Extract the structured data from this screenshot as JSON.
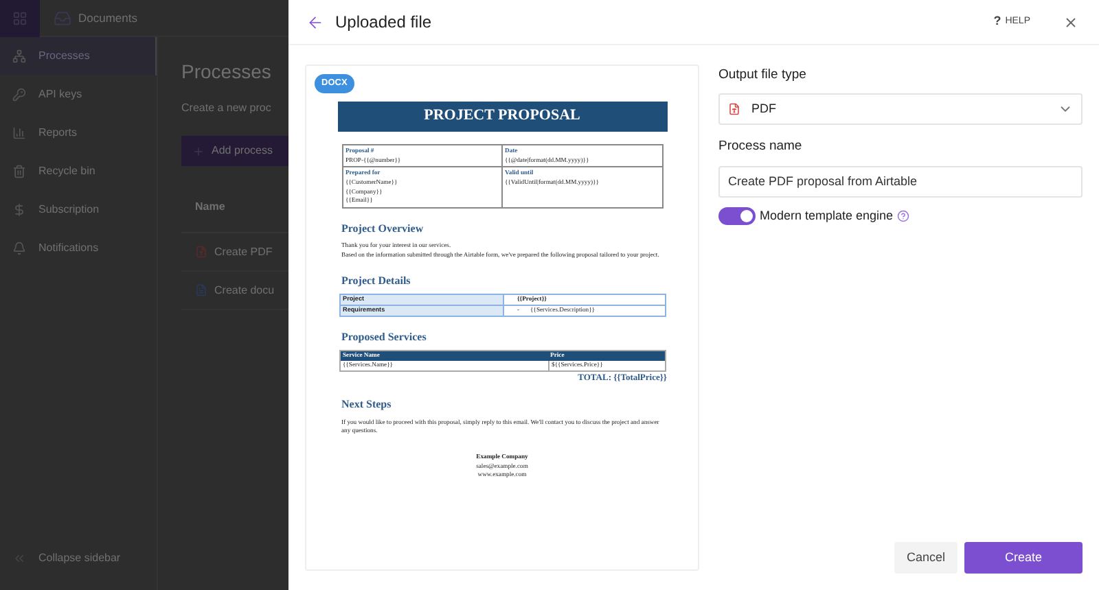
{
  "app": {
    "topbar": {
      "title": "Documents"
    },
    "sidebar": {
      "items": [
        {
          "label": "Processes",
          "selected": true
        },
        {
          "label": "API keys",
          "selected": false
        },
        {
          "label": "Reports",
          "selected": false
        },
        {
          "label": "Recycle bin",
          "selected": false
        },
        {
          "label": "Subscription",
          "selected": false
        },
        {
          "label": "Notifications",
          "selected": false
        }
      ],
      "collapse": "Collapse sidebar"
    },
    "main": {
      "title": "Processes",
      "subtitle": "Create a new proc",
      "add_button": "Add process",
      "table": {
        "columns": [
          "Name"
        ],
        "rows": [
          {
            "name": "Create PDF",
            "kind": "pdf"
          },
          {
            "name": "Create docu",
            "kind": "doc"
          }
        ]
      }
    }
  },
  "modal": {
    "title": "Uploaded file",
    "help_mark": "?",
    "help": "HELP",
    "preview": {
      "badge": "DOCX",
      "document": {
        "title": "PROJECT PROPOSAL",
        "info": [
          {
            "label": "Proposal #",
            "lines": [
              "PROP-{{@number}}"
            ]
          },
          {
            "label": "Date",
            "lines": [
              "{{@date|format(dd.MM.yyyy)}}"
            ]
          },
          {
            "label": "Prepared for",
            "lines": [
              "{{CustomerName}}",
              "{{Company}}",
              "{{Email}}"
            ]
          },
          {
            "label": "Valid until",
            "lines": [
              "{{ValidUntil|format(dd.MM.yyyy)}}"
            ]
          }
        ],
        "overview": {
          "heading": "Project Overview",
          "lines": [
            "Thank you for your interest in our services.",
            "Based on the information submitted through the Airtable form, we've prepared the following proposal tailored to your project."
          ]
        },
        "details": {
          "heading": "Project Details",
          "rows": [
            {
              "label": "Project",
              "value": "{{Project}}",
              "bullet": ""
            },
            {
              "label": "Requirements",
              "bullet": "-",
              "value": "{{Services.Description}}"
            }
          ]
        },
        "services": {
          "heading": "Proposed Services",
          "columns": [
            "Service Name",
            "Price"
          ],
          "row": [
            "{{Services.Name}}",
            "${{Services.Price}}"
          ],
          "total": "TOTAL: {{TotalPrice}}"
        },
        "next": {
          "heading": "Next Steps",
          "text": "If you would like to proceed with this proposal, simply reply to this email. We'll contact you to discuss the project and answer any questions."
        },
        "footer": {
          "company": "Example Company",
          "email": "sales@example.com",
          "web": "www.example.com"
        }
      }
    },
    "form": {
      "output_type": {
        "label": "Output file type",
        "value": "PDF"
      },
      "process_name": {
        "label": "Process name",
        "value": "Create PDF proposal from Airtable"
      },
      "toggle": {
        "label": "Modern template engine",
        "on": true
      }
    },
    "buttons": [
      {
        "label": "Cancel",
        "kind": "secondary"
      },
      {
        "label": "Create",
        "kind": "primary"
      }
    ]
  }
}
